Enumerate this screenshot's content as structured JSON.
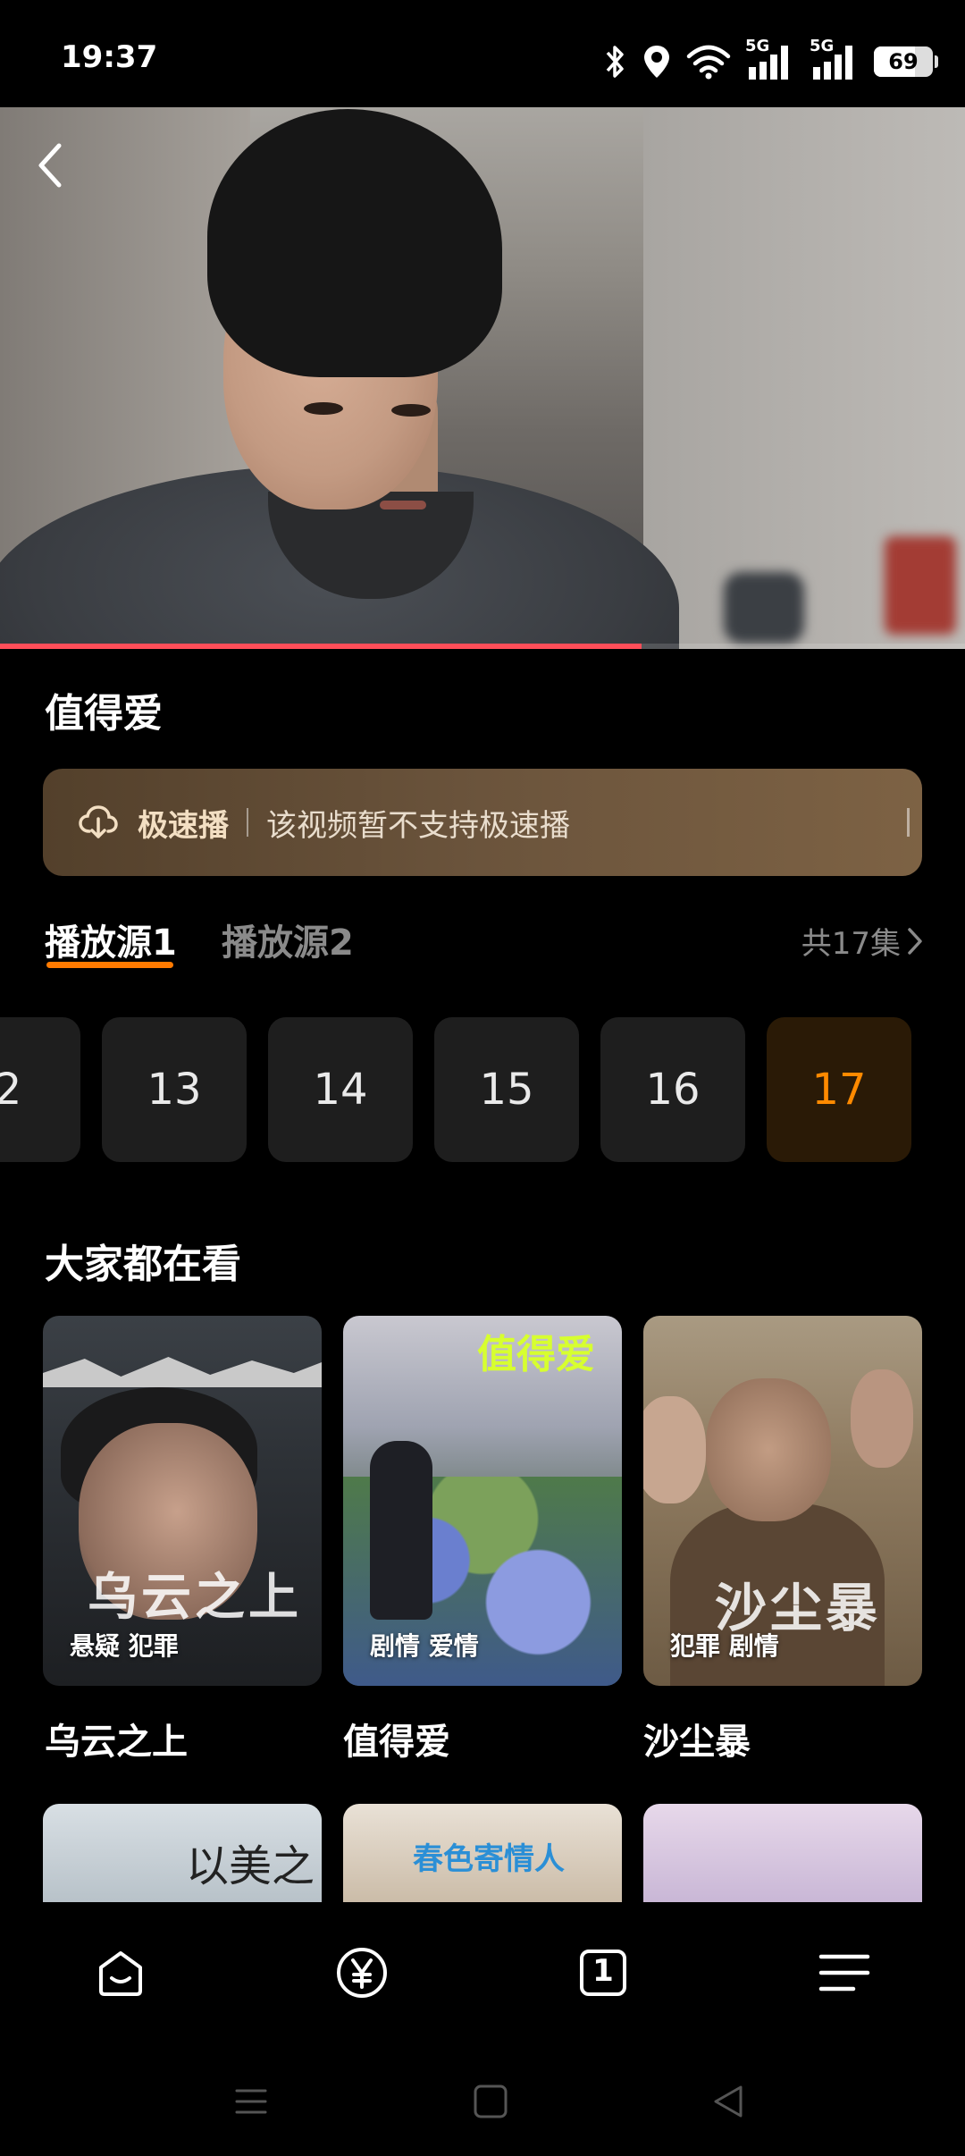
{
  "status_bar": {
    "time": "19:37",
    "battery": "69",
    "battery_level": 0.69,
    "signal_5g_1": "5G",
    "signal_5g_2": "5G"
  },
  "player": {
    "progress": 0.665,
    "title": "值得爱"
  },
  "speed_banner": {
    "label": "极速播",
    "message": "该视频暂不支持极速播"
  },
  "sources": {
    "tabs": [
      "播放源1",
      "播放源2"
    ],
    "active_index": 0,
    "episode_count_label": "共17集"
  },
  "episodes": {
    "items": [
      "2",
      "13",
      "14",
      "15",
      "16",
      "17"
    ],
    "current": "17"
  },
  "popular": {
    "title": "大家都在看",
    "items": [
      {
        "name": "乌云之上",
        "tags": "悬疑 犯罪",
        "poster_text": "乌云之上"
      },
      {
        "name": "值得爱",
        "tags": "剧情 爱情",
        "poster_text": "值得爱"
      },
      {
        "name": "沙尘暴",
        "tags": "犯罪 剧情",
        "poster_text": "沙尘暴"
      }
    ],
    "row2_poster_text": [
      "以美之名",
      "春色寄情人"
    ]
  },
  "bottom_nav": {
    "items": [
      "home-icon",
      "yuan-icon",
      "tabs-icon",
      "menu-icon"
    ],
    "tab_count": "1"
  },
  "colors": {
    "accent": "#ff7a00",
    "progress": "#ff4e59",
    "current_episode": "#ff8a00"
  }
}
